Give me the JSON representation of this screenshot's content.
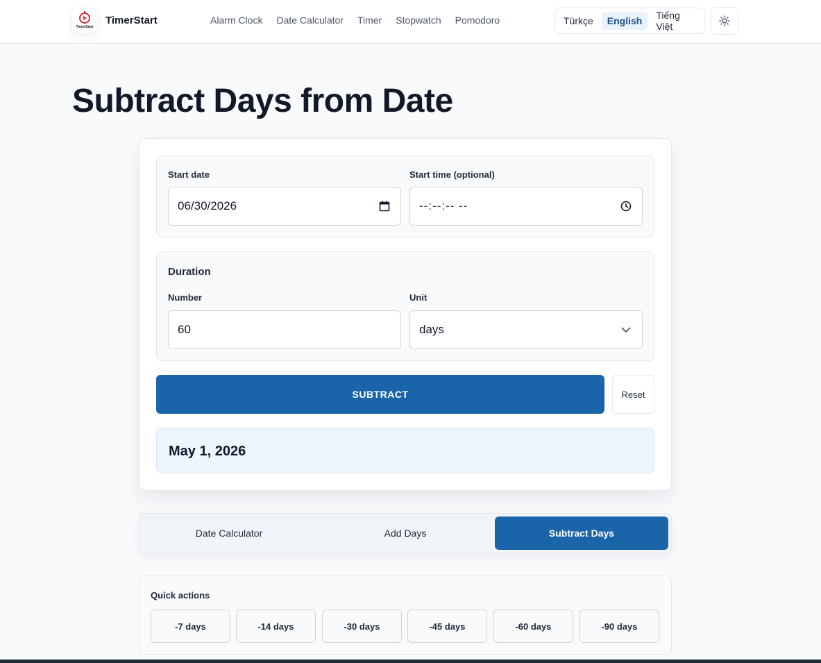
{
  "header": {
    "brand": "TimerStart",
    "logo_text": "TimerStart",
    "nav": [
      "Alarm Clock",
      "Date Calculator",
      "Timer",
      "Stopwatch",
      "Pomodoro"
    ],
    "languages": [
      "Türkçe",
      "English",
      "Tiếng Việt"
    ],
    "active_language": "English",
    "theme_icon": "sun-icon"
  },
  "page": {
    "title": "Subtract Days from Date"
  },
  "form": {
    "start_date_label": "Start date",
    "start_date_value": "06/30/2026",
    "start_time_label": "Start time (optional)",
    "start_time_value": "--:--:-- --",
    "duration_title": "Duration",
    "number_label": "Number",
    "number_value": "60",
    "unit_label": "Unit",
    "unit_value": "days",
    "submit_label": "SUBTRACT",
    "reset_label": "Reset",
    "result": "May 1, 2026"
  },
  "tabs": [
    "Date Calculator",
    "Add Days",
    "Subtract Days"
  ],
  "active_tab": "Subtract Days",
  "quick_actions": {
    "title": "Quick actions",
    "items": [
      "-7 days",
      "-14 days",
      "-30 days",
      "-45 days",
      "-60 days",
      "-90 days"
    ]
  },
  "colors": {
    "accent": "#1a64a9",
    "result_bg": "#eef5fd",
    "logo_red": "#d62f3a"
  }
}
